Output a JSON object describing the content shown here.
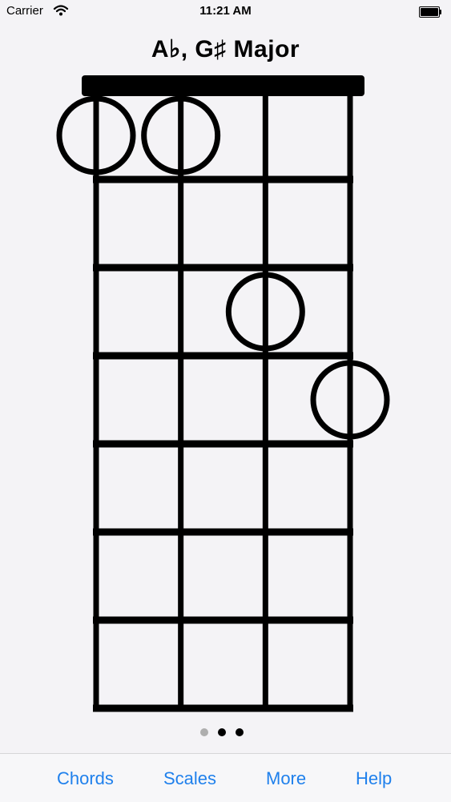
{
  "status_bar": {
    "carrier": "Carrier",
    "time": "11:21 AM",
    "wifi_icon": "wifi-icon",
    "battery_icon": "battery-icon"
  },
  "chord": {
    "name": "A♭, G♯ Major",
    "strings": 4,
    "frets_shown": 7,
    "markers": [
      {
        "string": 1,
        "fret": 0
      },
      {
        "string": 2,
        "fret": 0
      },
      {
        "string": 3,
        "fret": 2
      },
      {
        "string": 4,
        "fret": 3
      }
    ]
  },
  "page_indicator": {
    "count": 3,
    "current": 2
  },
  "tab_bar": {
    "chords": "Chords",
    "scales": "Scales",
    "more": "More",
    "help": "Help"
  },
  "colors": {
    "accent": "#1f80ec",
    "background": "#f4f3f6",
    "ink": "#000000"
  }
}
